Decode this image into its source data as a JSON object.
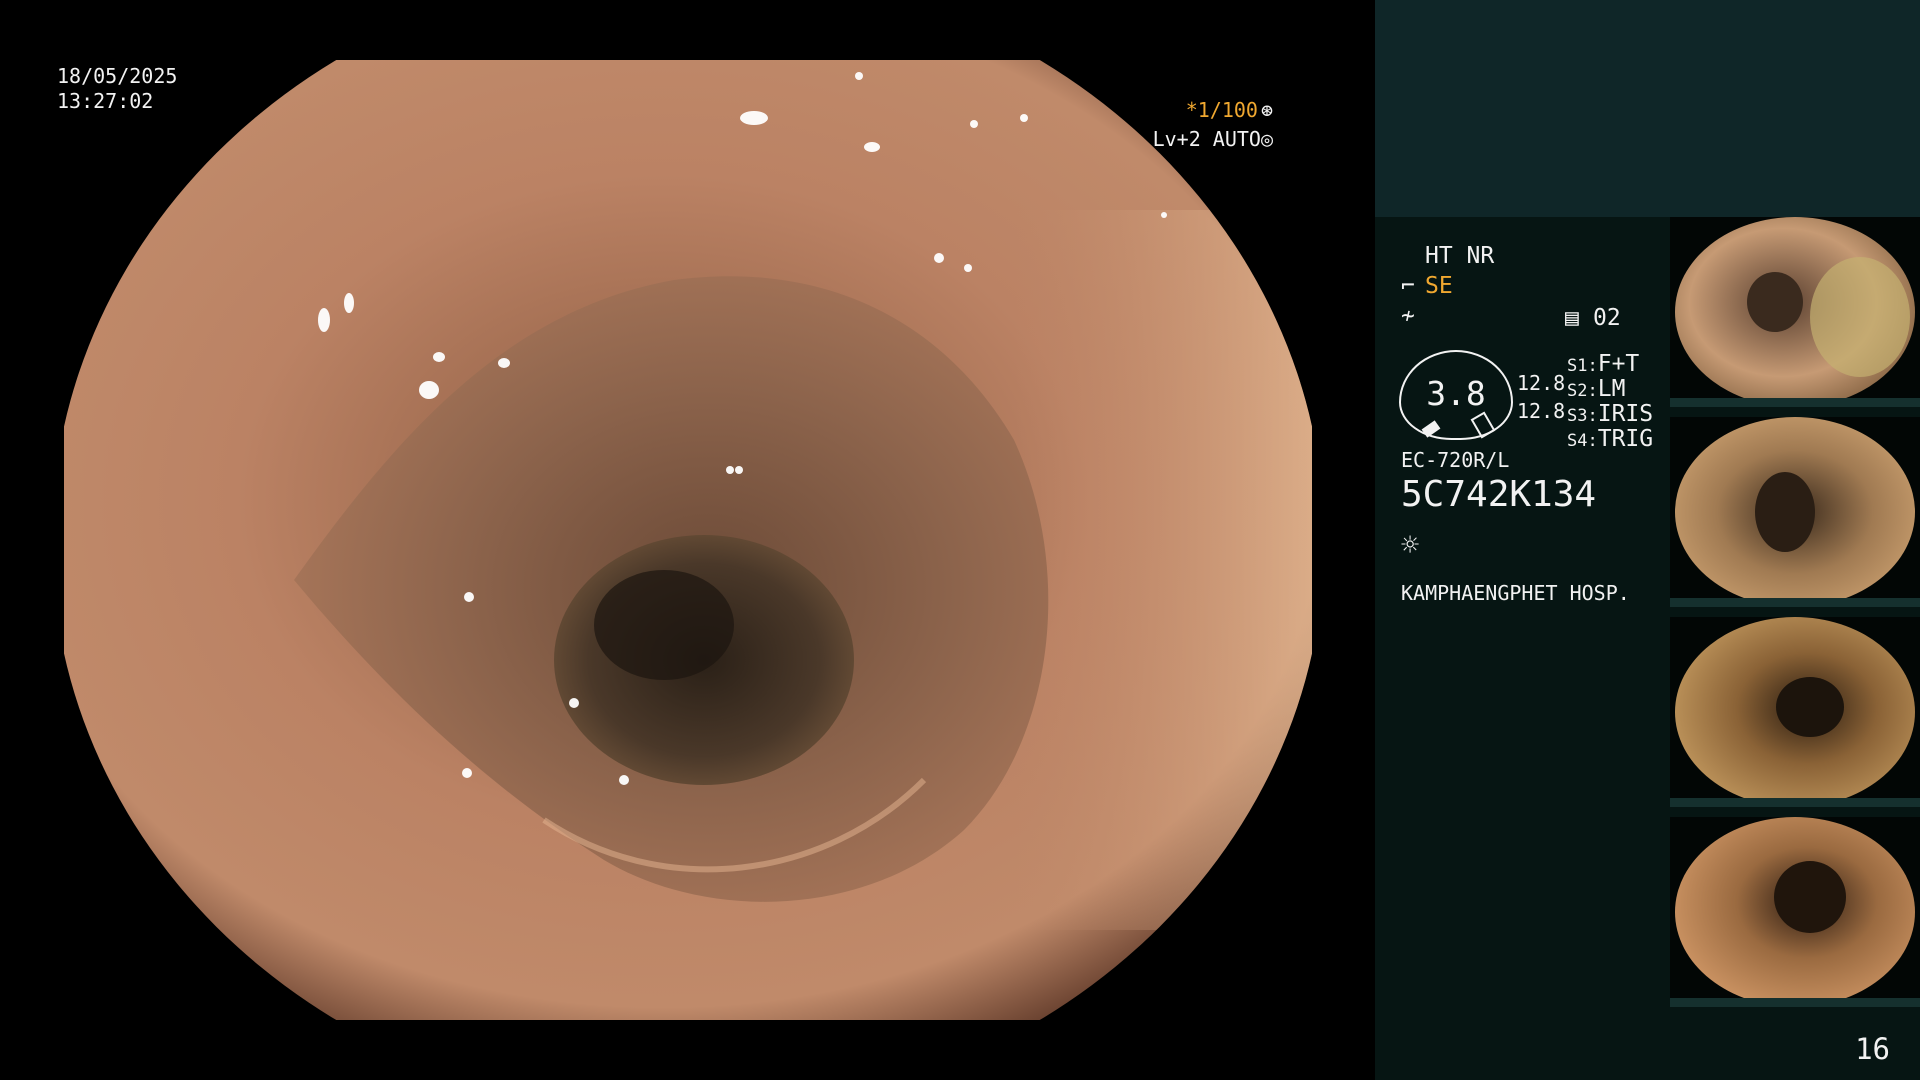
{
  "overlay": {
    "date": "18/05/2025",
    "time": "13:27:02",
    "shutter": "*1/100",
    "iris": "Lv+2 AUTO"
  },
  "panel": {
    "mode_line": "HT NR",
    "se_label": "SE",
    "channel": "02",
    "gauge_value": "3.8",
    "pressure_1": "12.8",
    "pressure_2": "12.8",
    "switches": [
      {
        "key": "S1:",
        "value": "F+T"
      },
      {
        "key": "S2:",
        "value": "LM"
      },
      {
        "key": "S3:",
        "value": "IRIS"
      },
      {
        "key": "S4:",
        "value": "TRIG"
      }
    ],
    "scope_model": "EC-720R/L",
    "serial": "5C742K134",
    "hospital": "KAMPHAENGPHET HOSP."
  },
  "page_number": "16",
  "icons": {
    "shutter": "aperture-icon",
    "iris": "iris-icon",
    "se": "scope-se-icon",
    "signal": "signal-icon",
    "channel": "document-icon",
    "light": "light-icon"
  },
  "colors": {
    "accent": "#f0a830",
    "panel_bg": "#061513",
    "panel_top": "#0f2628",
    "text": "#f2f2f2"
  }
}
